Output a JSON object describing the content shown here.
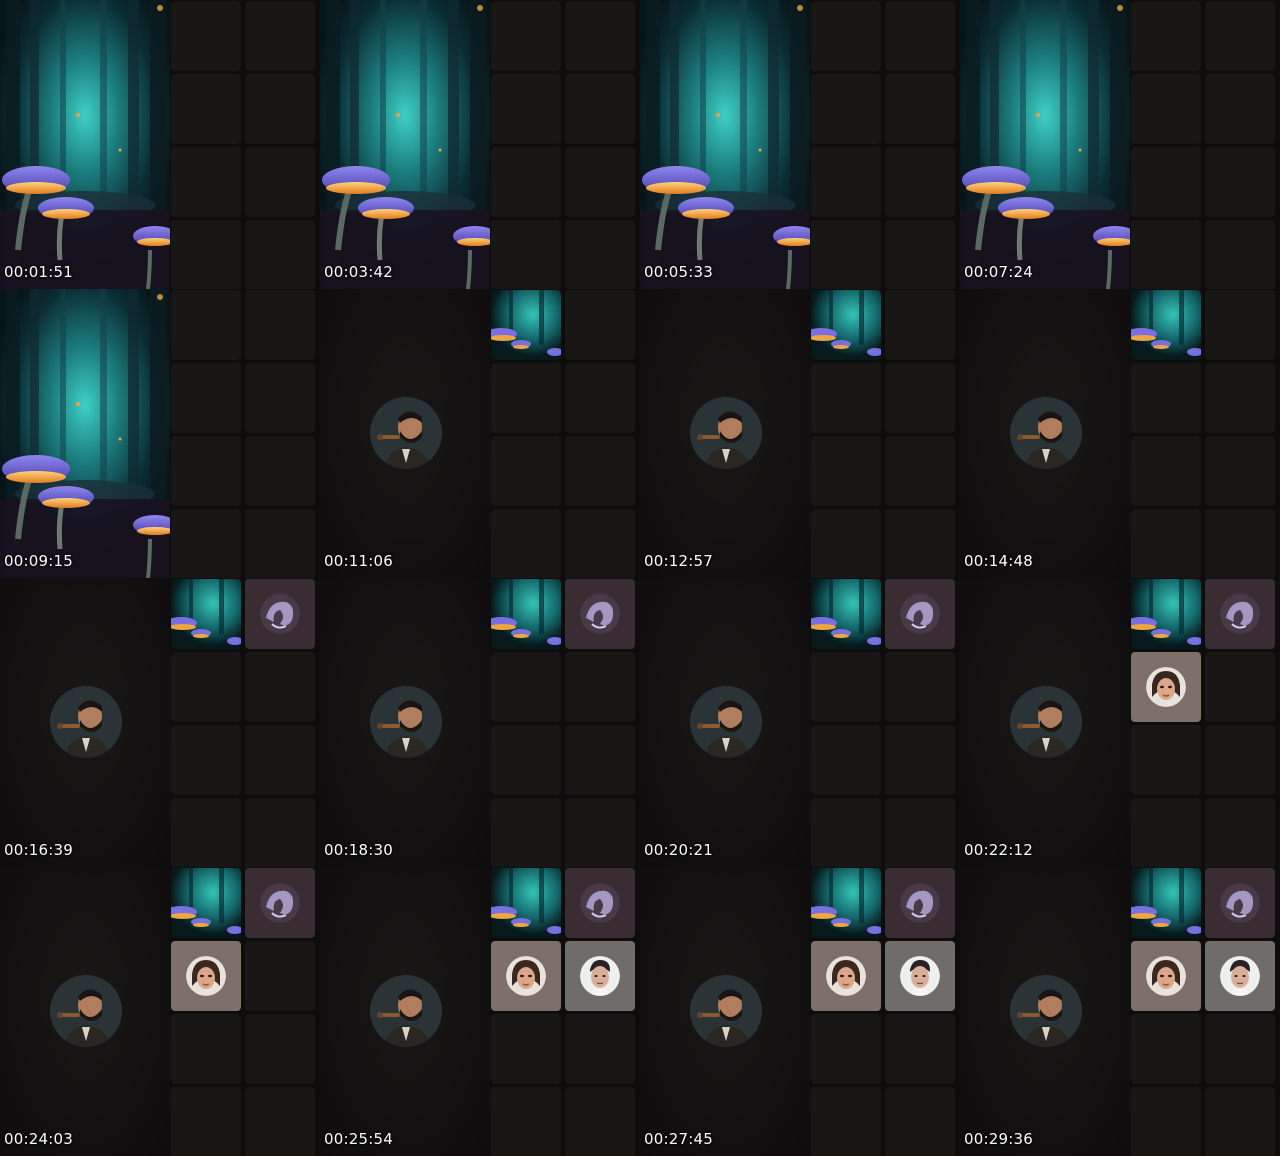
{
  "contact_sheet": {
    "frames": [
      {
        "timestamp": "00:01:51",
        "main": "forest",
        "tiles": []
      },
      {
        "timestamp": "00:03:42",
        "main": "forest",
        "tiles": []
      },
      {
        "timestamp": "00:05:33",
        "main": "forest",
        "tiles": []
      },
      {
        "timestamp": "00:07:24",
        "main": "forest",
        "tiles": []
      },
      {
        "timestamp": "00:09:15",
        "main": "forest",
        "tiles": []
      },
      {
        "timestamp": "00:11:06",
        "main": "host-avatar",
        "tiles": [
          "forest"
        ]
      },
      {
        "timestamp": "00:12:57",
        "main": "host-avatar",
        "tiles": [
          "forest"
        ]
      },
      {
        "timestamp": "00:14:48",
        "main": "host-avatar",
        "tiles": [
          "forest"
        ]
      },
      {
        "timestamp": "00:16:39",
        "main": "host-avatar",
        "tiles": [
          "forest",
          "purple-avatar"
        ]
      },
      {
        "timestamp": "00:18:30",
        "main": "host-avatar",
        "tiles": [
          "forest",
          "purple-avatar"
        ]
      },
      {
        "timestamp": "00:20:21",
        "main": "host-avatar",
        "tiles": [
          "forest",
          "purple-avatar"
        ]
      },
      {
        "timestamp": "00:22:12",
        "main": "host-avatar",
        "tiles": [
          "forest",
          "purple-avatar",
          "woman-avatar"
        ]
      },
      {
        "timestamp": "00:24:03",
        "main": "host-avatar",
        "tiles": [
          "forest",
          "purple-avatar",
          "woman-avatar"
        ]
      },
      {
        "timestamp": "00:25:54",
        "main": "host-avatar",
        "tiles": [
          "forest",
          "purple-avatar",
          "woman-avatar",
          "man-avatar"
        ]
      },
      {
        "timestamp": "00:27:45",
        "main": "host-avatar",
        "tiles": [
          "forest",
          "purple-avatar",
          "woman-avatar",
          "man-avatar"
        ]
      },
      {
        "timestamp": "00:29:36",
        "main": "host-avatar",
        "tiles": [
          "forest",
          "purple-avatar",
          "woman-avatar",
          "man-avatar"
        ]
      }
    ]
  },
  "colors": {
    "background": "#0c0b0b",
    "empty_tile": "#181716",
    "forest_teal": "#1f8f8f",
    "mushroom_purple": "#6a5bd0",
    "mushroom_glow": "#f2a23a",
    "timestamp_text": "#ffffff"
  }
}
